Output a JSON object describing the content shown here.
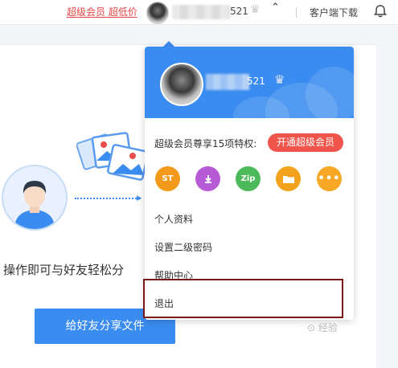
{
  "topbar": {
    "promo": "超级会员 超低价",
    "username_suffix": "521",
    "client_download": "客户端下载"
  },
  "main": {
    "description": "操作即可与好友轻松分",
    "share_button": "给好友分享文件"
  },
  "dropdown": {
    "username_suffix": "521",
    "perk_title": "超级会员尊享15项特权:",
    "vip_button": "开通超级会员",
    "perks": [
      {
        "icon": "speed-icon",
        "color": "#f39a1d",
        "label": "ST"
      },
      {
        "icon": "download-icon",
        "color": "#b65ad6",
        "label": ""
      },
      {
        "icon": "zip-icon",
        "color": "#4cba5a",
        "label": "Zip"
      },
      {
        "icon": "folder-icon",
        "color": "#f3a21d",
        "label": ""
      },
      {
        "icon": "more-icon",
        "color": "#f7a726",
        "label": ""
      }
    ],
    "menu": {
      "profile": "个人资料",
      "second_password": "设置二级密码",
      "help_center": "帮助中心",
      "logout": "退出"
    }
  },
  "watermark": "⊙ 经验",
  "colors": {
    "brand_blue": "#3b8cf0",
    "promo_red": "#e64646",
    "vip_red": "#f0554c",
    "highlight_box": "#7a1818"
  }
}
